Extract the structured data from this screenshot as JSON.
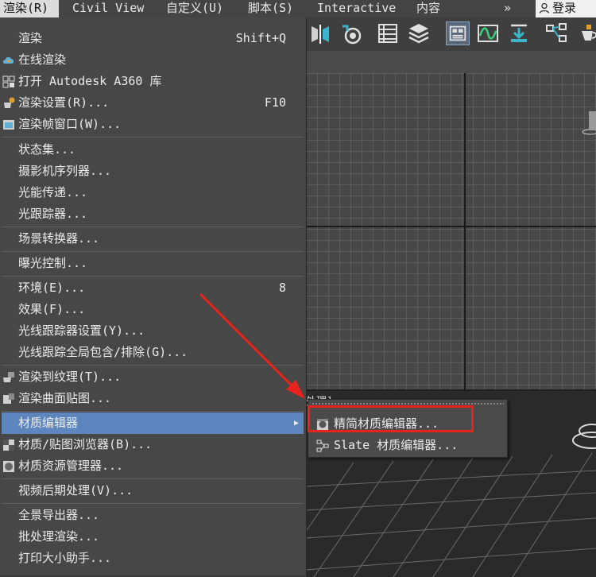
{
  "menubar": {
    "items": [
      "渲染(R)",
      "Civil View",
      "自定义(U)",
      "脚本(S)",
      "Interactive",
      "内容"
    ],
    "overflow": "»",
    "login": "登录"
  },
  "viewport": {
    "partial_label": "处理]"
  },
  "render_menu": {
    "items": [
      {
        "label": "渲染",
        "shortcut": "Shift+Q",
        "icon": ""
      },
      {
        "label": "在线渲染",
        "shortcut": "",
        "icon": "cloud-icon"
      },
      {
        "label": "打开 Autodesk A360 库",
        "shortcut": "",
        "icon": "grid-icon"
      },
      {
        "label": "渲染设置(R)...",
        "shortcut": "F10",
        "icon": "teapot-gear-icon"
      },
      {
        "label": "渲染帧窗口(W)...",
        "shortcut": "",
        "icon": "frame-window-icon"
      },
      {
        "label": "状态集...",
        "shortcut": "",
        "icon": ""
      },
      {
        "label": "摄影机序列器...",
        "shortcut": "",
        "icon": ""
      },
      {
        "label": "光能传递...",
        "shortcut": "",
        "icon": ""
      },
      {
        "label": "光跟踪器...",
        "shortcut": "",
        "icon": ""
      },
      {
        "label": "场景转换器...",
        "shortcut": "",
        "icon": ""
      },
      {
        "label": "曝光控制...",
        "shortcut": "",
        "icon": ""
      },
      {
        "label": "环境(E)...",
        "shortcut": "8",
        "icon": ""
      },
      {
        "label": "效果(F)...",
        "shortcut": "",
        "icon": ""
      },
      {
        "label": "光线跟踪器设置(Y)...",
        "shortcut": "",
        "icon": ""
      },
      {
        "label": "光线跟踪全局包含/排除(G)...",
        "shortcut": "",
        "icon": ""
      },
      {
        "label": "渲染到纹理(T)...",
        "shortcut": "",
        "icon": "teapot-texture-icon"
      },
      {
        "label": "渲染曲面贴图...",
        "shortcut": "",
        "icon": "surface-map-icon"
      },
      {
        "label": "材质编辑器",
        "shortcut": "",
        "icon": ""
      },
      {
        "label": "材质/贴图浏览器(B)...",
        "shortcut": "",
        "icon": "checker-icon"
      },
      {
        "label": "材质资源管理器...",
        "shortcut": "",
        "icon": "checker-sphere-icon"
      },
      {
        "label": "视频后期处理(V)...",
        "shortcut": "",
        "icon": ""
      },
      {
        "label": "全景导出器...",
        "shortcut": "",
        "icon": ""
      },
      {
        "label": "批处理渲染...",
        "shortcut": "",
        "icon": ""
      },
      {
        "label": "打印大小助手...",
        "shortcut": "",
        "icon": ""
      }
    ],
    "submenu_arrow": "▶"
  },
  "material_submenu": {
    "items": [
      {
        "label": "精简材质编辑器...",
        "icon": "compact-material-editor-icon"
      },
      {
        "label": "Slate 材质编辑器...",
        "icon": "slate-node-icon"
      }
    ]
  },
  "colors": {
    "highlight": "#5d86bf",
    "annotation_red": "#e8231c"
  }
}
